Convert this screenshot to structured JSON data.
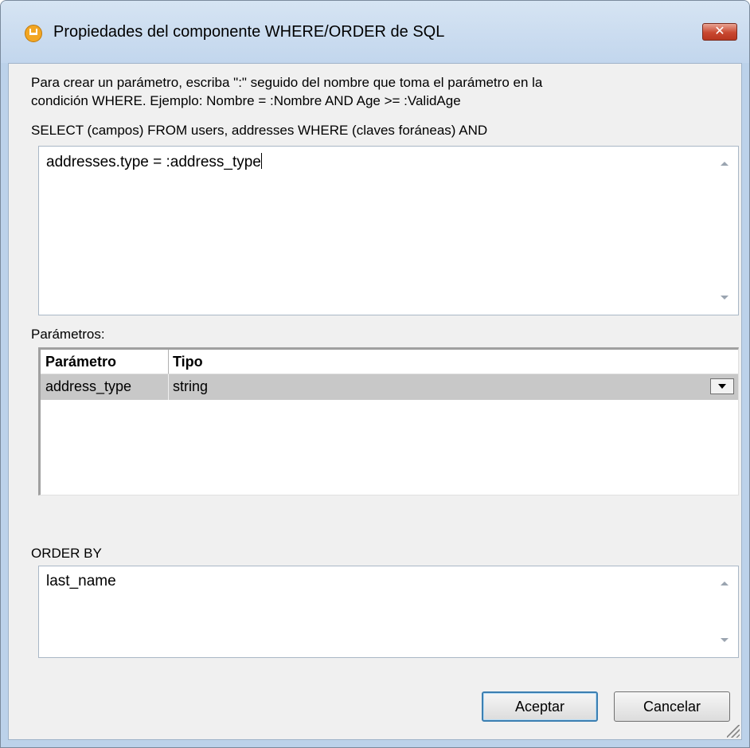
{
  "window": {
    "title": "Propiedades del componente WHERE/ORDER de SQL",
    "close_symbol": "✕",
    "app_icon": "altova-mapforce-icon"
  },
  "instructions": {
    "line1": "Para crear un parámetro, escriba \":\" seguido del nombre que toma el parámetro en la",
    "line2": "condición WHERE. Ejemplo: Nombre = :Nombre AND Age >= :ValidAge"
  },
  "where": {
    "label": "SELECT (campos) FROM users, addresses WHERE (claves foráneas) AND",
    "value": "addresses.type = :address_type"
  },
  "parameters": {
    "label": "Parámetros:",
    "columns": [
      "Parámetro",
      "Tipo"
    ],
    "rows": [
      {
        "name": "address_type",
        "type": "string"
      }
    ]
  },
  "order_by": {
    "label": "ORDER BY",
    "value": "last_name"
  },
  "buttons": {
    "ok": "Aceptar",
    "cancel": "Cancelar"
  }
}
